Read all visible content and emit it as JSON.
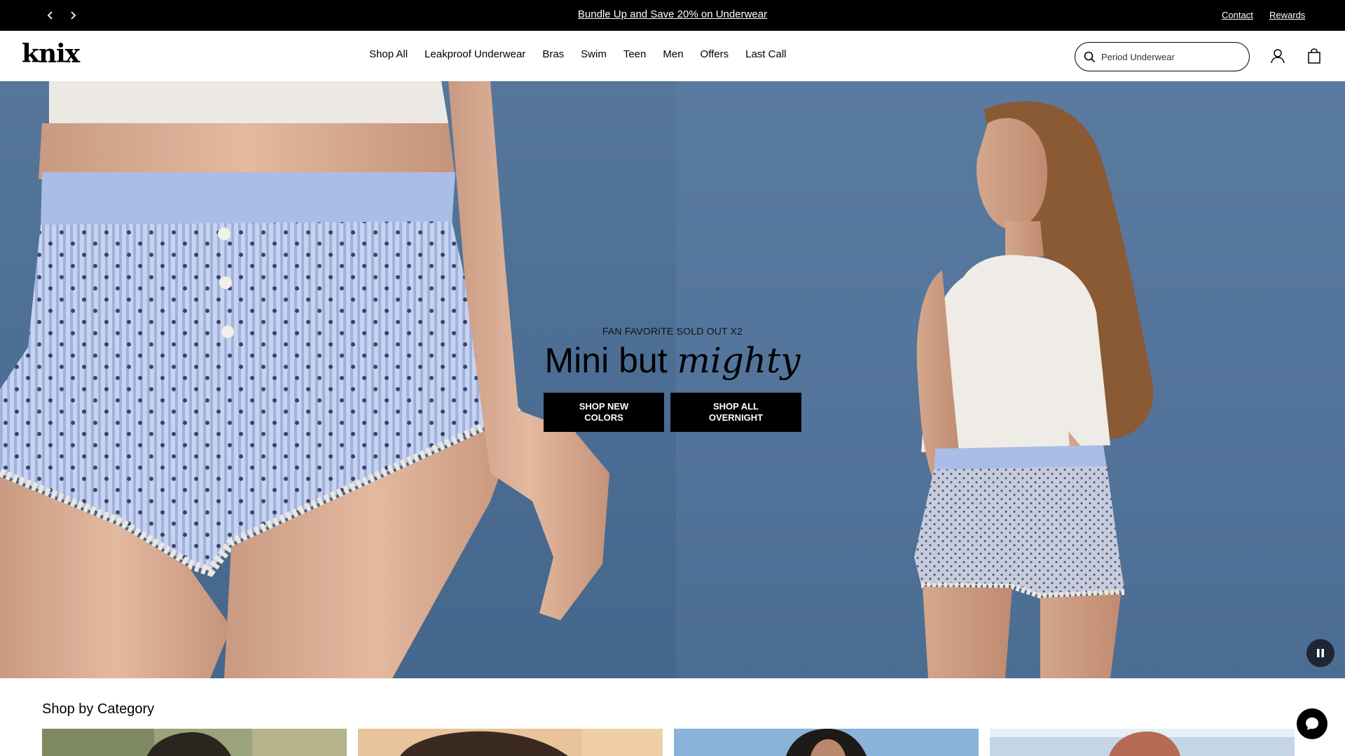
{
  "announcement": {
    "prev_icon": "chevron-left-icon",
    "next_icon": "chevron-right-icon",
    "promo_text": "Bundle Up and Save 20% on Underwear",
    "links": {
      "contact": "Contact",
      "rewards": "Rewards"
    }
  },
  "header": {
    "logo_text": "knix",
    "nav": [
      "Shop All",
      "Leakproof Underwear",
      "Bras",
      "Swim",
      "Teen",
      "Men",
      "Offers",
      "Last Call"
    ],
    "search": {
      "placeholder": "Period Underwear",
      "icon": "search-icon"
    },
    "account_icon": "user-icon",
    "cart_icon": "shopping-bag-icon"
  },
  "hero": {
    "eyebrow": "FAN FAVORITE SOLD OUT X2",
    "headline_plain": "Mini but",
    "headline_italic": "mighty",
    "buttons": {
      "shop_new_colors": "SHOP NEW COLORS",
      "shop_all_overnight": "SHOP ALL OVERNIGHT"
    },
    "pause_icon": "pause-icon"
  },
  "category_section": {
    "title": "Shop by Category"
  },
  "chat_icon": "chat-bubble-icon",
  "colors": {
    "announcement_bg": "#000000",
    "hero_blue": "#52739a",
    "shorts_blue": "#a9bde6",
    "cta_bg": "#000000",
    "pause_bg": "#1d2635"
  }
}
